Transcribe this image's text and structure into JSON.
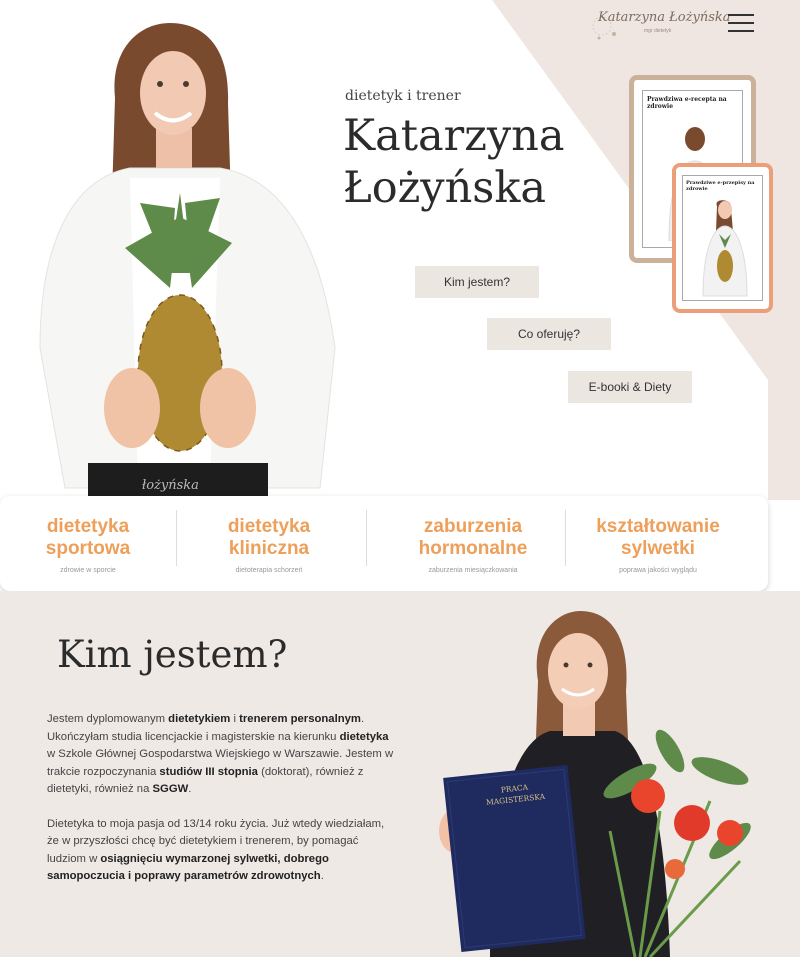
{
  "header": {
    "logo_text": "Katarzyna Łożyńska",
    "logo_subtext": "mgr dietetyk",
    "menu_icon": "hamburger-icon"
  },
  "hero": {
    "subtitle": "dietetyk i trener",
    "name_line1": "Katarzyna",
    "name_line2": "Łożyńska",
    "buttons": {
      "about": "Kim jestem?",
      "offer": "Co oferuję?",
      "ebooks": "E-booki & Diety"
    },
    "ebook_title_1": "Prawdziwa e-recepta na zdrowie",
    "ebook_title_2": "Prawdziwe e-przepisy na zdrowie",
    "watermark": "łożyńska"
  },
  "specializations": [
    {
      "line1": "dietetyka",
      "line2": "sportowa",
      "sub": "zdrowie w sporcie"
    },
    {
      "line1": "dietetyka",
      "line2": "kliniczna",
      "sub": "dietoterapia schorzeń"
    },
    {
      "line1": "zaburzenia",
      "line2": "hormonalne",
      "sub": "zaburzenia miesiączkowania"
    },
    {
      "line1": "kształtowanie",
      "line2": "sylwetki",
      "sub": "poprawa jakości wyglądu"
    }
  ],
  "about": {
    "heading": "Kim jestem?",
    "p1": [
      "Jestem dyplomowanym ",
      "dietetykiem",
      " i ",
      "trenerem personalnym",
      ". Ukończyłam studia licencjackie i magisterskie na kierunku ",
      "dietetyka",
      " w Szkole Głównej Gospodarstwa Wiejskiego w Warszawie. Jestem w trakcie rozpoczynania ",
      "studiów III stopnia",
      " (doktorat), również z dietetyki, również na ",
      "SGGW",
      "."
    ],
    "p2": [
      "Dietetyka to moja pasja od 13/14 roku życia. Już wtedy wiedziałam, że w przyszłości chcę być dietetykiem i trenerem, by pomagać ludziom w ",
      "osiągnięciu wymarzonej sylwetki, dobrego samopoczucia i poprawy parametrów zdrowotnych",
      "."
    ],
    "diploma_label": "PRACA MAGISTERSKA"
  },
  "colors": {
    "accent": "#ee9f5a",
    "beige": "#efe9e6",
    "button_bg": "#ece6e1"
  }
}
